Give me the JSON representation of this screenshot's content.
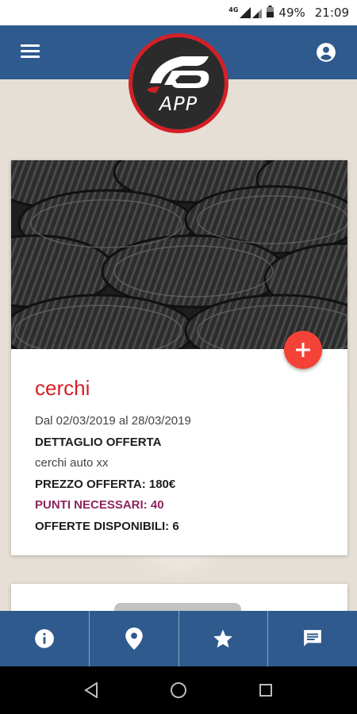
{
  "status_bar": {
    "network": "4G",
    "battery": "49%",
    "time": "21:09"
  },
  "app_bar": {
    "logo_text": "APP"
  },
  "offer": {
    "title": "cerchi",
    "date_range": "Dal 02/03/2019 al 28/03/2019",
    "detail_heading": "DETTAGLIO OFFERTA",
    "description": "cerchi auto xx",
    "price": "PREZZO OFFERTA: 180€",
    "points": "PUNTI NECESSARI: 40",
    "available": "OFFERTE DISPONIBILI: 6"
  },
  "bottom_nav": [
    {
      "icon": "info-icon"
    },
    {
      "icon": "location-pin-icon"
    },
    {
      "icon": "star-icon"
    },
    {
      "icon": "message-icon"
    }
  ],
  "colors": {
    "primary": "#2e5a8e",
    "accent_red": "#d32027",
    "fab": "#f44336",
    "points_purple": "#8e2461"
  }
}
